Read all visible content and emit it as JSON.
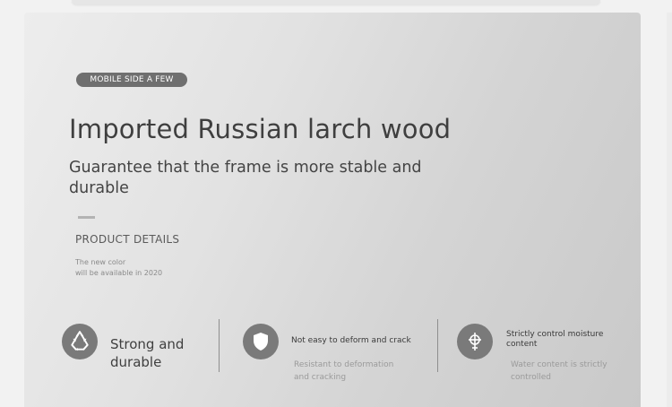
{
  "badge": "MOBILE SIDE A FEW",
  "title": "Imported Russian larch wood",
  "subtitle": "Guarantee that the frame is more stable and durable",
  "product_details_label": "PRODUCT DETAILS",
  "note": [
    "The new color",
    "will be available in 2020"
  ],
  "features": [
    {
      "icon": "recycle-icon",
      "title_lines": [
        "Strong and",
        "durable"
      ]
    },
    {
      "icon": "shield-icon",
      "title": "Not easy to deform and crack",
      "desc_lines": [
        "Resistant to deformation",
        "and cracking"
      ]
    },
    {
      "icon": "moisture-target-icon",
      "title_lines": [
        "Strictly control moisture",
        "content"
      ],
      "desc_lines": [
        "Water content is strictly",
        "controlled"
      ]
    }
  ],
  "colors": {
    "icon_bg": "#7a7a7a",
    "pill_bg": "#6f6f6f",
    "title": "#3f3f3f"
  }
}
